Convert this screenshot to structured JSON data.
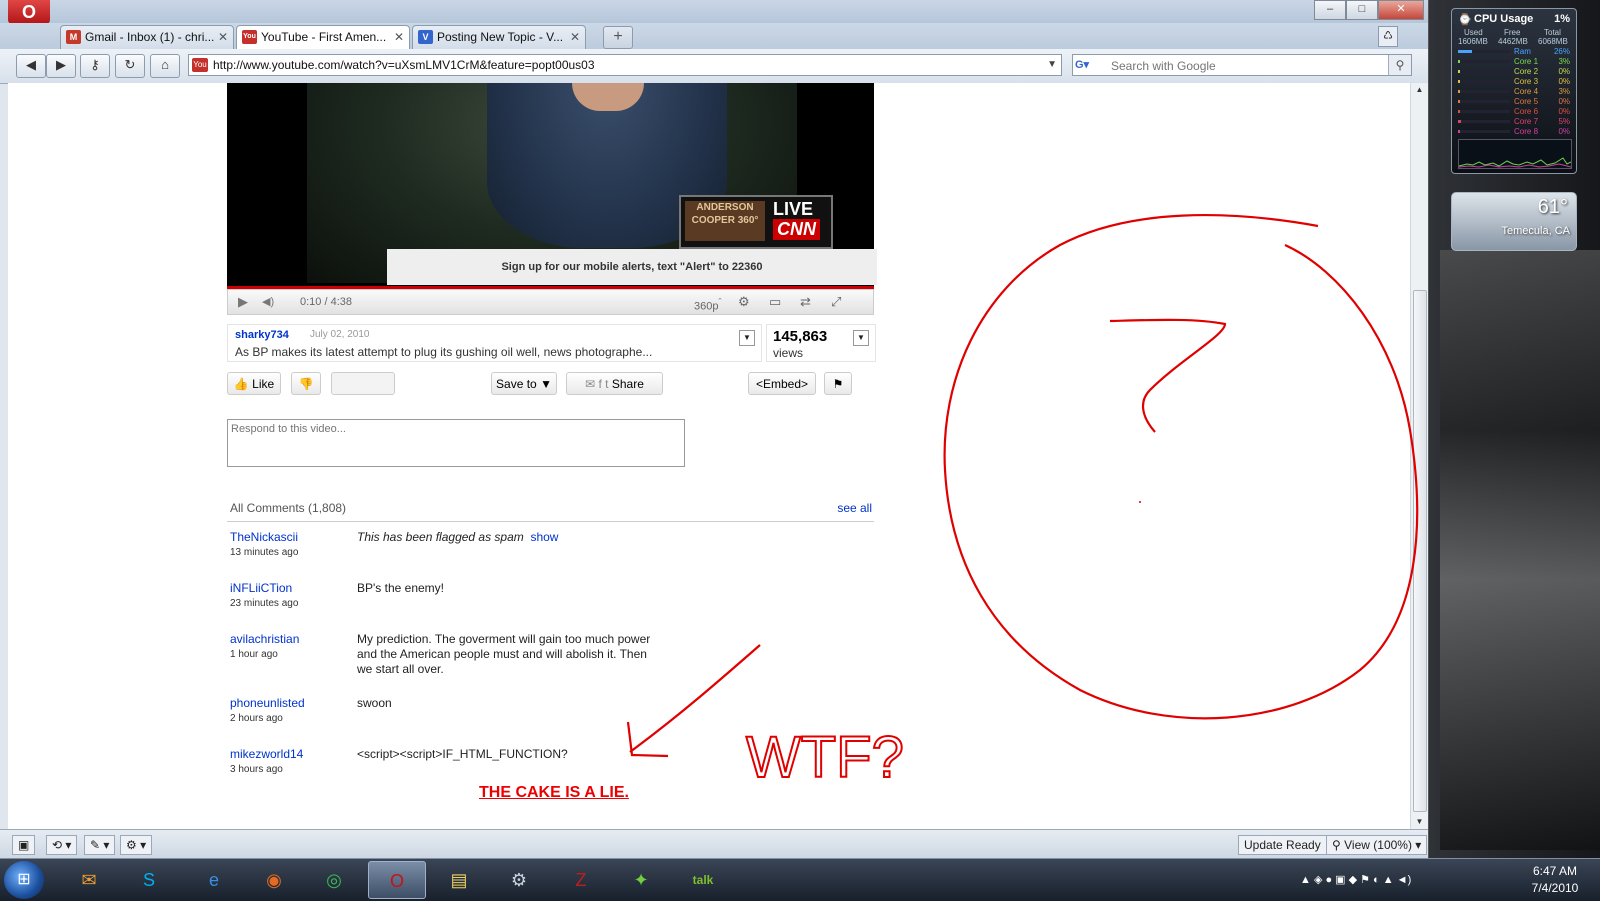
{
  "browser": {
    "opera_label": "O",
    "window_controls": [
      "–",
      "□",
      "✕"
    ],
    "tabs": [
      {
        "label": "Gmail - Inbox (1) - chri...",
        "icon": "gmail-icon",
        "icon_glyph": "M",
        "icon_color": "#c53929"
      },
      {
        "label": "YouTube - First Amen...",
        "icon": "youtube-icon",
        "icon_glyph": "You",
        "icon_color": "#c4302b"
      },
      {
        "label": "Posting New Topic - V...",
        "icon": "forum-icon",
        "icon_glyph": "V",
        "icon_color": "#3366cc"
      }
    ],
    "new_tab": "+",
    "trash_glyph": "♺",
    "nav": {
      "back": "◀",
      "forward": "▶",
      "wand": "⚷",
      "reload": "↻",
      "home": "⌂"
    },
    "url": "http://www.youtube.com/watch?v=uXsmLMV1CrM&feature=popt00us03",
    "url_icon": "You",
    "url_dropdown": "▼",
    "search_engine": "G▾",
    "search_placeholder": "Search with Google",
    "search_glyph": "⚲"
  },
  "video": {
    "alert_strip": "Sign up for our mobile alerts, text \"Alert\" to 22360",
    "logo_show": "ANDERSON COOPER 360°",
    "logo_live": "LIVE",
    "logo_network": "CNN",
    "controls": {
      "play": "▶",
      "volume": "◀)",
      "time": "0:10 / 4:38",
      "quality": "360p",
      "quality_sup": "ˆ",
      "btn_a": "⚙",
      "btn_b": "▭",
      "btn_c": "⇄",
      "btn_d": "⤢"
    },
    "progress_fraction": 0.04
  },
  "info": {
    "user": "sharky734",
    "date": "July 02, 2010",
    "description": "As BP makes its latest attempt to plug its gushing oil well, news photographe...",
    "views": "145,863",
    "views_label": "views",
    "expand_glyph": "▼"
  },
  "actions": {
    "like": "Like",
    "like_icon": "👍",
    "dislike_icon": "👎",
    "save_to": "Save to",
    "save_to_arrow": "▼",
    "share": "Share",
    "share_icons": "✉ f t",
    "embed": "<Embed>",
    "flag_icon": "⚑"
  },
  "respond": {
    "placeholder": "Respond to this video..."
  },
  "comments": {
    "header": "All Comments (1,808)",
    "see_all": "see all",
    "items": [
      {
        "user": "TheNickascii",
        "time": "13 minutes ago",
        "text": "This has been flagged as spam",
        "show": "show"
      },
      {
        "user": "iNFLiiCTion",
        "time": "23 minutes ago",
        "text": "BP's the enemy!"
      },
      {
        "user": "avilachristian",
        "time": "1 hour ago",
        "text": "My prediction. The goverment will gain too much power and the American people must and will abolish it. Then we start all over."
      },
      {
        "user": "phoneunlisted",
        "time": "2 hours ago",
        "text": "swoon"
      },
      {
        "user": "mikezworld14",
        "time": "3 hours ago",
        "text": "<script><script>IF_HTML_FUNCTION?"
      }
    ]
  },
  "annotations": {
    "cake": "THE CAKE IS A LIE.",
    "wtf": "WTF?",
    "question": "?",
    "color": "#e00000"
  },
  "statusbar": {
    "update": "Update Ready",
    "view": "View (100%)",
    "view_arrow": "▾",
    "left_icons": [
      "▣",
      "⟲ ▾",
      "✎ ▾",
      "⚙ ▾"
    ]
  },
  "cpu_gadget": {
    "title": "CPU Usage",
    "percent": "1%",
    "cols": [
      "Used",
      "Free",
      "Total"
    ],
    "mem": [
      "1606MB",
      "4462MB",
      "6068MB"
    ],
    "rows": [
      {
        "label": "Ram",
        "value": "26%",
        "color": "#4aa3ff",
        "fill": 0.26
      },
      {
        "label": "Core 1",
        "value": "3%",
        "color": "#7fd94f",
        "fill": 0.03
      },
      {
        "label": "Core 2",
        "value": "0%",
        "color": "#c8d94f",
        "fill": 0.0
      },
      {
        "label": "Core 3",
        "value": "0%",
        "color": "#e0c040",
        "fill": 0.0
      },
      {
        "label": "Core 4",
        "value": "3%",
        "color": "#e09a40",
        "fill": 0.03
      },
      {
        "label": "Core 5",
        "value": "0%",
        "color": "#e07840",
        "fill": 0.0
      },
      {
        "label": "Core 6",
        "value": "0%",
        "color": "#e05040",
        "fill": 0.0
      },
      {
        "label": "Core 7",
        "value": "5%",
        "color": "#e04070",
        "fill": 0.05
      },
      {
        "label": "Core 8",
        "value": "0%",
        "color": "#d040a0",
        "fill": 0.0
      }
    ]
  },
  "weather": {
    "temp": "61°",
    "city": "Temecula, CA"
  },
  "taskbar": {
    "start": "⊞",
    "apps": [
      {
        "name": "outlook",
        "glyph": "✉",
        "color": "#f0a030"
      },
      {
        "name": "skype",
        "glyph": "S",
        "color": "#00aff0"
      },
      {
        "name": "ie",
        "glyph": "e",
        "color": "#3a8ee6"
      },
      {
        "name": "firefox",
        "glyph": "◉",
        "color": "#e66a1f"
      },
      {
        "name": "chrome",
        "glyph": "◎",
        "color": "#3cba54"
      },
      {
        "name": "opera",
        "glyph": "O",
        "color": "#cc1010"
      },
      {
        "name": "explorer",
        "glyph": "▤",
        "color": "#f0d060"
      },
      {
        "name": "steam",
        "glyph": "⚙",
        "color": "#c6d4df"
      },
      {
        "name": "filezilla",
        "glyph": "Z",
        "color": "#bf1e1e"
      },
      {
        "name": "gadget",
        "glyph": "✦",
        "color": "#6fcf3f"
      },
      {
        "name": "gtalk",
        "glyph": "talk",
        "color": "#7fbf2f"
      }
    ],
    "tray_icons": "▲ ◈ ● ▣ ◆ ⚑ ◐ ▲ ◄)",
    "time": "6:47 AM",
    "date": "7/4/2010"
  }
}
